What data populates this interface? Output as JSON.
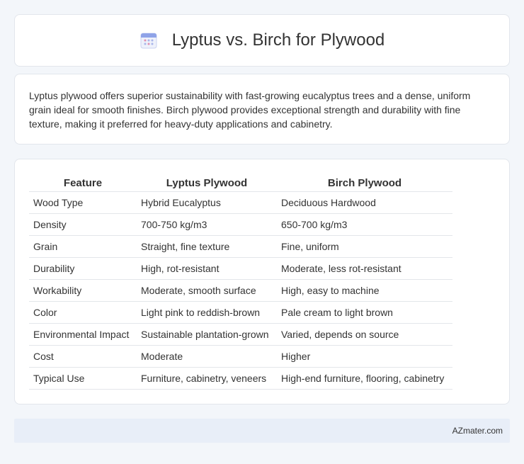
{
  "header": {
    "icon": "calendar-icon",
    "title": "Lyptus vs. Birch for Plywood"
  },
  "summary": {
    "text": "Lyptus plywood offers superior sustainability with fast-growing eucalyptus trees and a dense, uniform grain ideal for smooth finishes. Birch plywood provides exceptional strength and durability with fine texture, making it preferred for heavy-duty applications and cabinetry."
  },
  "table": {
    "headers": [
      "Feature",
      "Lyptus Plywood",
      "Birch Plywood"
    ],
    "rows": [
      [
        "Wood Type",
        "Hybrid Eucalyptus",
        "Deciduous Hardwood"
      ],
      [
        "Density",
        "700-750 kg/m3",
        "650-700 kg/m3"
      ],
      [
        "Grain",
        "Straight, fine texture",
        "Fine, uniform"
      ],
      [
        "Durability",
        "High, rot-resistant",
        "Moderate, less rot-resistant"
      ],
      [
        "Workability",
        "Moderate, smooth surface",
        "High, easy to machine"
      ],
      [
        "Color",
        "Light pink to reddish-brown",
        "Pale cream to light brown"
      ],
      [
        "Environmental Impact",
        "Sustainable plantation-grown",
        "Varied, depends on source"
      ],
      [
        "Cost",
        "Moderate",
        "Higher"
      ],
      [
        "Typical Use",
        "Furniture, cabinetry, veneers",
        "High-end furniture, flooring, cabinetry"
      ]
    ]
  },
  "footer": {
    "text": "AZmater.com"
  },
  "colors": {
    "background": "#f3f6fa",
    "card": "#ffffff",
    "footer": "#e8eef8",
    "icon_accent": "#8fa3e8"
  }
}
